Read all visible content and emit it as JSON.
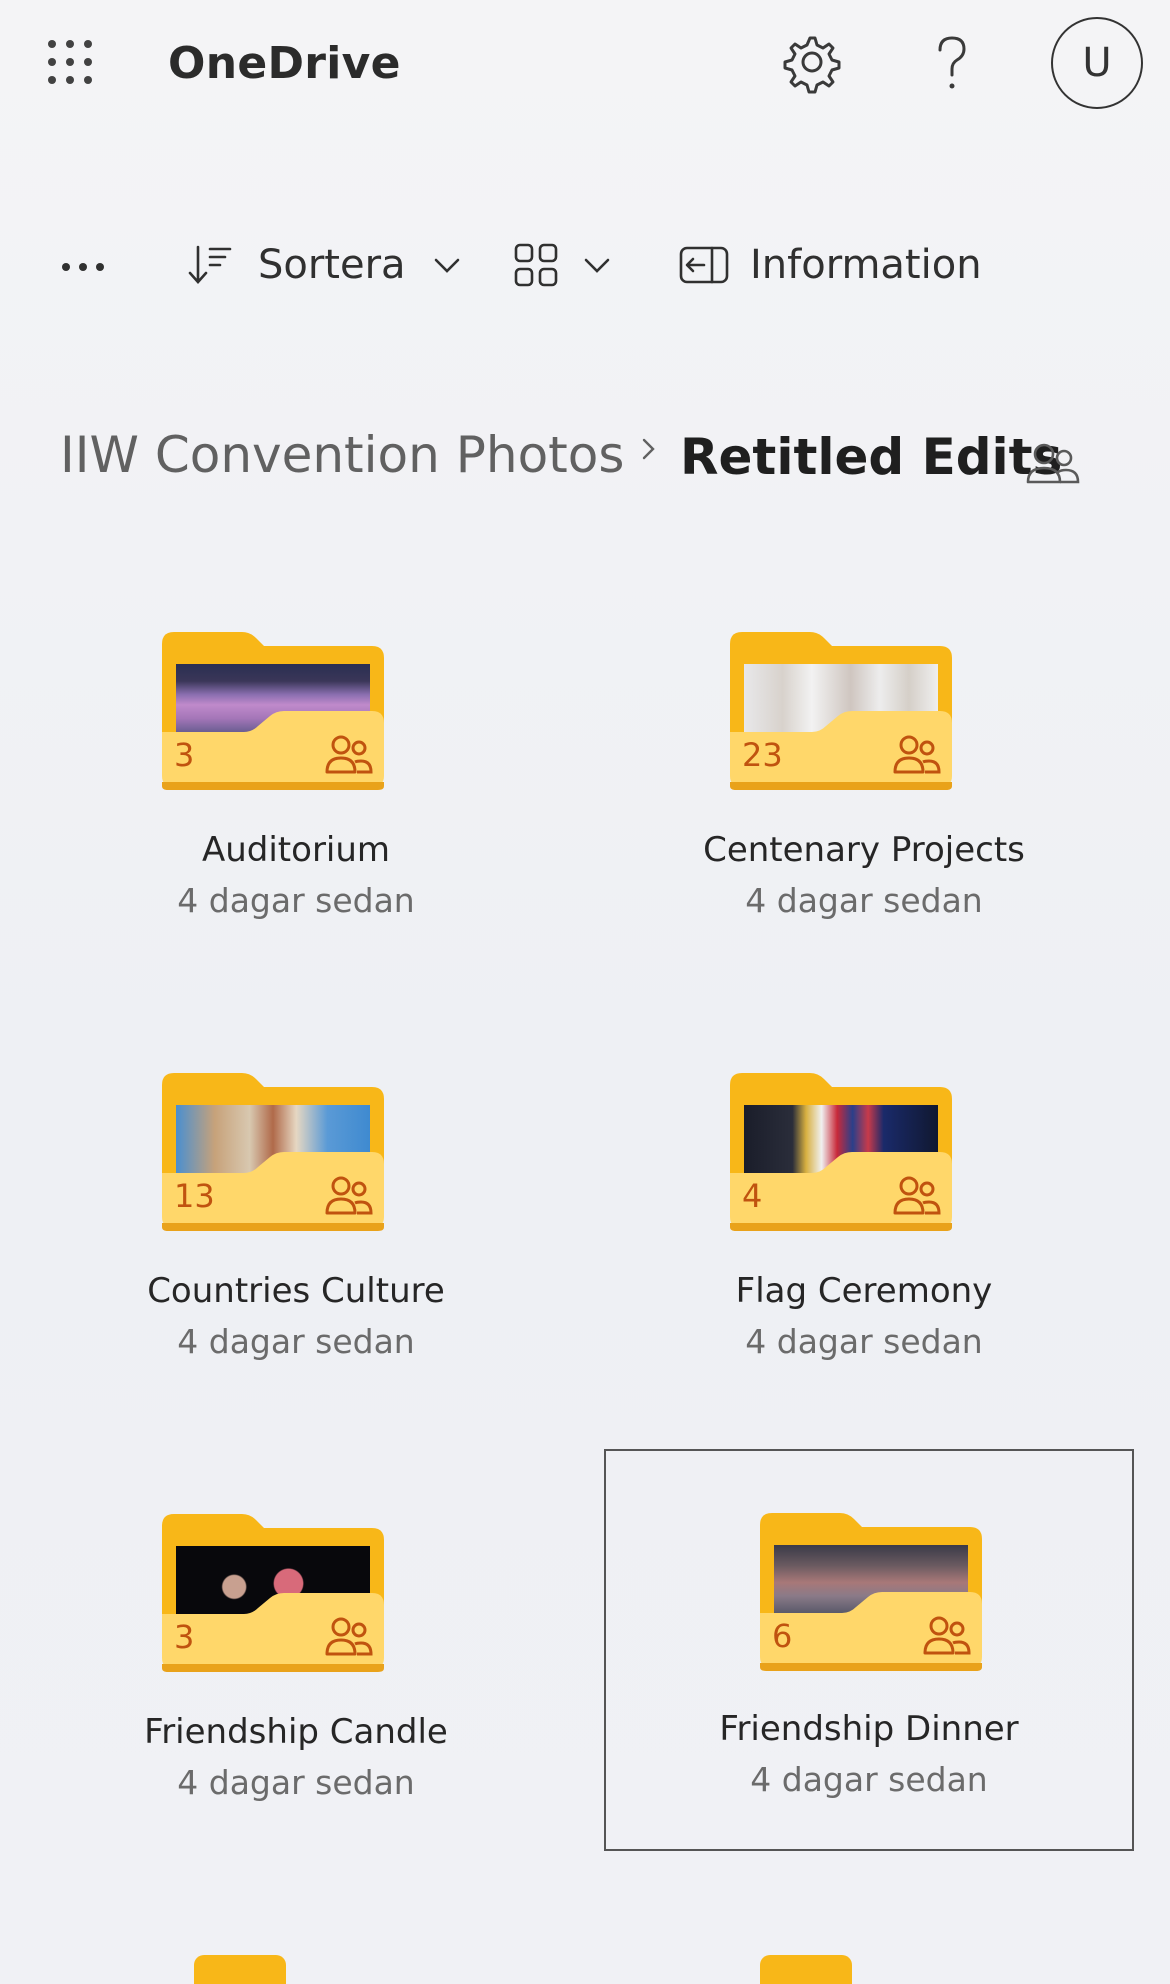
{
  "header": {
    "app_title": "OneDrive",
    "avatar_initial": "U",
    "icons": [
      "app-launcher-icon",
      "settings-gear-icon",
      "help-question-icon"
    ]
  },
  "commandbar": {
    "sort_label": "Sortera",
    "info_label": "Information"
  },
  "breadcrumb": {
    "parent": "IIW Convention Photos",
    "current": "Retitled Edits"
  },
  "folders": [
    {
      "name": "Auditorium",
      "date": "4 dagar sedan",
      "count": "3"
    },
    {
      "name": "Centenary Projects",
      "date": "4 dagar sedan",
      "count": "23"
    },
    {
      "name": "Countries Culture",
      "date": "4 dagar sedan",
      "count": "13"
    },
    {
      "name": "Flag Ceremony",
      "date": "4 dagar sedan",
      "count": "4"
    },
    {
      "name": "Friendship Candle",
      "date": "4 dagar sedan",
      "count": "3"
    },
    {
      "name": "Friendship Dinner",
      "date": "4 dagar sedan",
      "count": "6",
      "selected": true
    }
  ],
  "colors": {
    "folder_back": "#f8b718",
    "folder_front": "#ffd76a",
    "count_text": "#c0530f",
    "accent_border": "#555555"
  }
}
